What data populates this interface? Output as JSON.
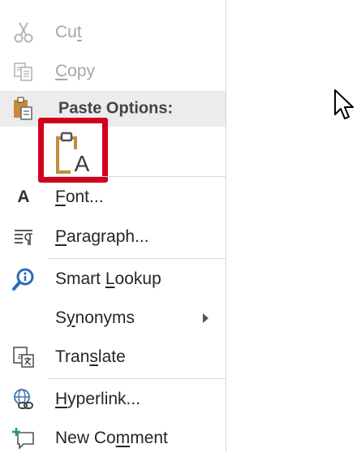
{
  "menu": {
    "cut": {
      "prefix": "Cu",
      "underline": "t",
      "suffix": "",
      "icon": "scissors-icon"
    },
    "copy": {
      "prefix": "",
      "underline": "C",
      "suffix": "opy",
      "icon": "copy-icon"
    },
    "paste_options": {
      "label": "Paste Options:",
      "icon": "paste-icon"
    },
    "paste_keep_text": {
      "icon": "paste-keep-text-only-icon"
    },
    "font": {
      "prefix": "",
      "underline": "F",
      "suffix": "ont...",
      "icon": "font-icon",
      "glyph": "A"
    },
    "paragraph": {
      "prefix": "",
      "underline": "P",
      "suffix": "aragraph...",
      "icon": "paragraph-icon"
    },
    "smart_lookup": {
      "prefix": "Smart ",
      "underline": "L",
      "suffix": "ookup",
      "icon": "smart-lookup-icon"
    },
    "synonyms": {
      "prefix": "S",
      "underline": "y",
      "suffix": "nonyms",
      "icon": "submenu-arrow-icon"
    },
    "translate": {
      "prefix": "Tran",
      "underline": "s",
      "suffix": "late",
      "icon": "translate-icon"
    },
    "hyperlink": {
      "prefix": "",
      "underline": "H",
      "suffix": "yperlink...",
      "icon": "hyperlink-icon"
    },
    "new_comment": {
      "prefix": "New Co",
      "underline": "m",
      "suffix": "ment",
      "icon": "new-comment-icon"
    }
  },
  "colors": {
    "highlight_box": "#d0021b",
    "accent_blue": "#2b6cb8",
    "header_bg": "#ececec"
  }
}
